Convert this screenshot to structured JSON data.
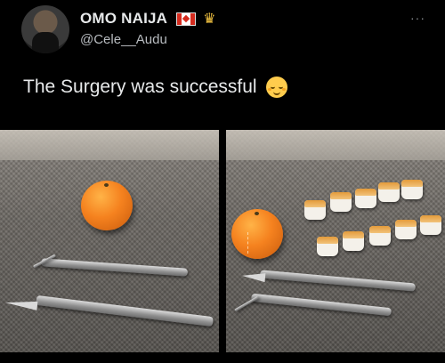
{
  "tweet": {
    "display_name": "OMO NAIJA",
    "handle": "@Cele__Audu",
    "text": "The Surgery was successful",
    "badges": [
      "canada-flag-icon",
      "crown-icon"
    ],
    "more_icon": "more-options-icon",
    "emoji": "relieved-face-emoji"
  },
  "media": {
    "count": 2,
    "images": [
      {
        "subject": "orange-with-scalpel-and-tweezers"
      },
      {
        "subject": "orange-with-peeled-segments-scalpel-and-tweezers"
      }
    ]
  },
  "colors": {
    "background": "#000000",
    "text_primary": "#e7e9ea",
    "text_secondary": "#b8bcc0"
  }
}
